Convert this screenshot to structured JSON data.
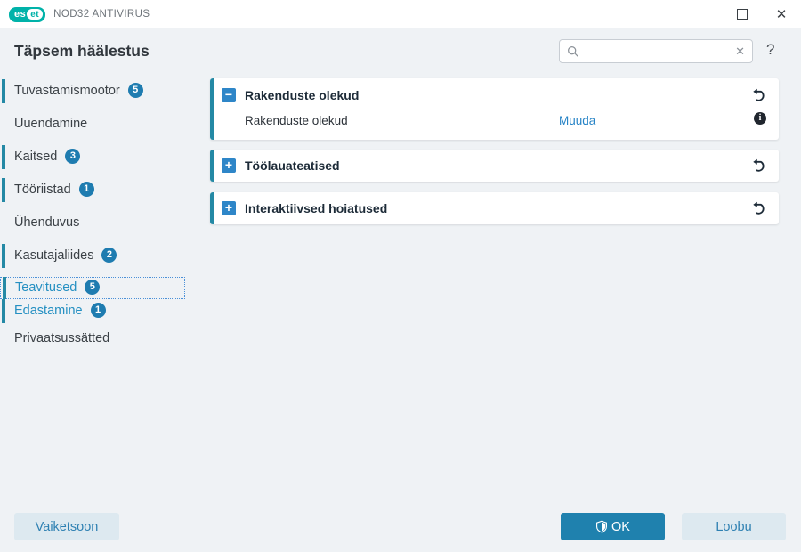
{
  "colors": {
    "brand_teal": "#00b2a9",
    "accent_bar": "#2489a5",
    "badge_bg": "#1e7cb0",
    "expander_bg": "#2e86c8",
    "link_blue": "#2683c6",
    "selected_blue": "#2590c2",
    "ok_button_bg": "#1f81ae",
    "light_button_bg": "#dde9f0",
    "light_button_text": "#2e80b2",
    "background": "#eff2f5",
    "panel_bg": "#ffffff",
    "dark_text": "#1d2b38"
  },
  "titlebar": {
    "logo_left": "es",
    "logo_right": "et",
    "product_name": "NOD32 ANTIVIRUS"
  },
  "header": {
    "title": "Täpsem häälestus",
    "search_value": "",
    "help_label": "?"
  },
  "sidebar": {
    "items": [
      {
        "label": "Tuvastamismootor",
        "badge": "5"
      },
      {
        "label": "Uuendamine",
        "badge": ""
      },
      {
        "label": "Kaitsed",
        "badge": "3"
      },
      {
        "label": "Tööriistad",
        "badge": "1"
      },
      {
        "label": "Ühenduvus",
        "badge": ""
      },
      {
        "label": "Kasutajaliides",
        "badge": "2"
      },
      {
        "label": "Teavitused",
        "badge": "5"
      },
      {
        "label": "Edastamine",
        "badge": "1"
      },
      {
        "label": "Privaatsussätted",
        "badge": ""
      }
    ]
  },
  "panels": [
    {
      "title": "Rakenduste olekud",
      "expanded": true
    },
    {
      "title": "Töölauateatised",
      "expanded": false
    },
    {
      "title": "Interaktiivsed hoiatused",
      "expanded": false
    }
  ],
  "panel_row": {
    "label": "Rakenduste olekud",
    "action": "Muuda"
  },
  "footer": {
    "defaults_label": "Vaiketsoon",
    "ok_label": "OK",
    "cancel_label": "Loobu"
  }
}
